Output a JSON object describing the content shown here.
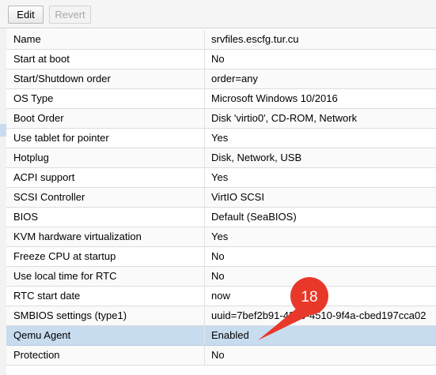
{
  "toolbar": {
    "edit_label": "Edit",
    "revert_label": "Revert"
  },
  "rows": [
    {
      "key": "Name",
      "value": "srvfiles.escfg.tur.cu"
    },
    {
      "key": "Start at boot",
      "value": "No"
    },
    {
      "key": "Start/Shutdown order",
      "value": "order=any"
    },
    {
      "key": "OS Type",
      "value": "Microsoft Windows 10/2016"
    },
    {
      "key": "Boot Order",
      "value": "Disk 'virtio0', CD-ROM, Network"
    },
    {
      "key": "Use tablet for pointer",
      "value": "Yes"
    },
    {
      "key": "Hotplug",
      "value": "Disk, Network, USB"
    },
    {
      "key": "ACPI support",
      "value": "Yes"
    },
    {
      "key": "SCSI Controller",
      "value": "VirtIO SCSI"
    },
    {
      "key": "BIOS",
      "value": "Default (SeaBIOS)"
    },
    {
      "key": "KVM hardware virtualization",
      "value": "Yes"
    },
    {
      "key": "Freeze CPU at startup",
      "value": "No"
    },
    {
      "key": "Use local time for RTC",
      "value": "No"
    },
    {
      "key": "RTC start date",
      "value": "now"
    },
    {
      "key": "SMBIOS settings (type1)",
      "value": "uuid=7bef2b91-4200-4510-9f4a-cbed197cca02"
    },
    {
      "key": "Qemu Agent",
      "value": "Enabled",
      "selected": true
    },
    {
      "key": "Protection",
      "value": "No"
    }
  ],
  "callout": {
    "label": "18",
    "color": "#e8382a"
  },
  "colors": {
    "selected_row": "#c8dcef"
  }
}
